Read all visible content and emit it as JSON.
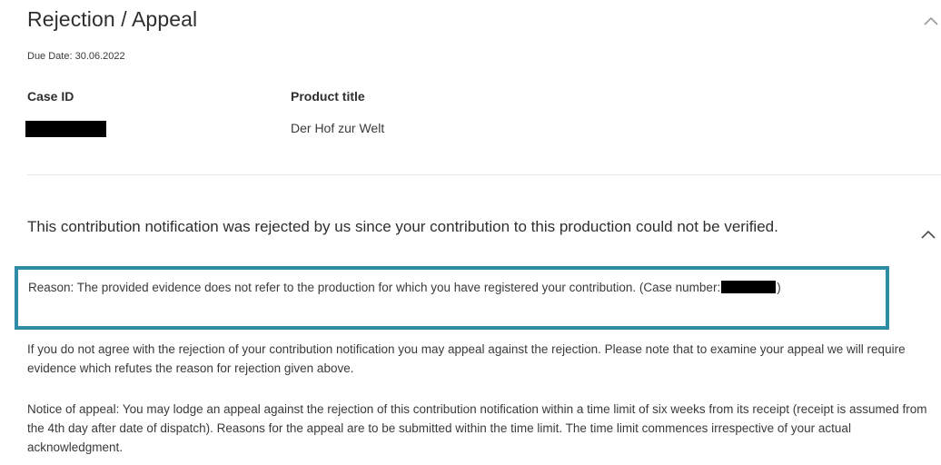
{
  "section": {
    "title": "Rejection / Appeal",
    "collapse_icon": "chevron-up-icon",
    "due_date": "Due Date: 30.06.2022"
  },
  "table": {
    "headers": {
      "case_id": "Case ID",
      "product_title": "Product title"
    },
    "row": {
      "case_id": "",
      "product_title": "Der Hof zur Welt"
    }
  },
  "rejection": {
    "heading": "This contribution notification was rejected by us since your contribution to this production could not be verified.",
    "collapse_icon": "chevron-up-icon",
    "reason_prefix": "Reason: The provided evidence does not refer to the production for which you have registered your contribution. (Case number:",
    "reason_suffix": ")",
    "disagree_text": "If you do not agree with the rejection of your contribution notification you may appeal against the rejection. Please note that to examine your appeal we will require evidence which refutes the reason for rejection given above.",
    "notice_text": "Notice of appeal: You may lodge an appeal against the rejection of this contribution notification within a time limit of six weeks from its receipt (receipt is assumed from the 4th day after date of dispatch). Reasons for the appeal are to be submitted within the time limit. The time limit commences irrespective of your actual acknowledgment."
  },
  "colors": {
    "highlight_border": "#2f8ca6",
    "text": "#3a3a3a",
    "redaction": "#000000"
  }
}
